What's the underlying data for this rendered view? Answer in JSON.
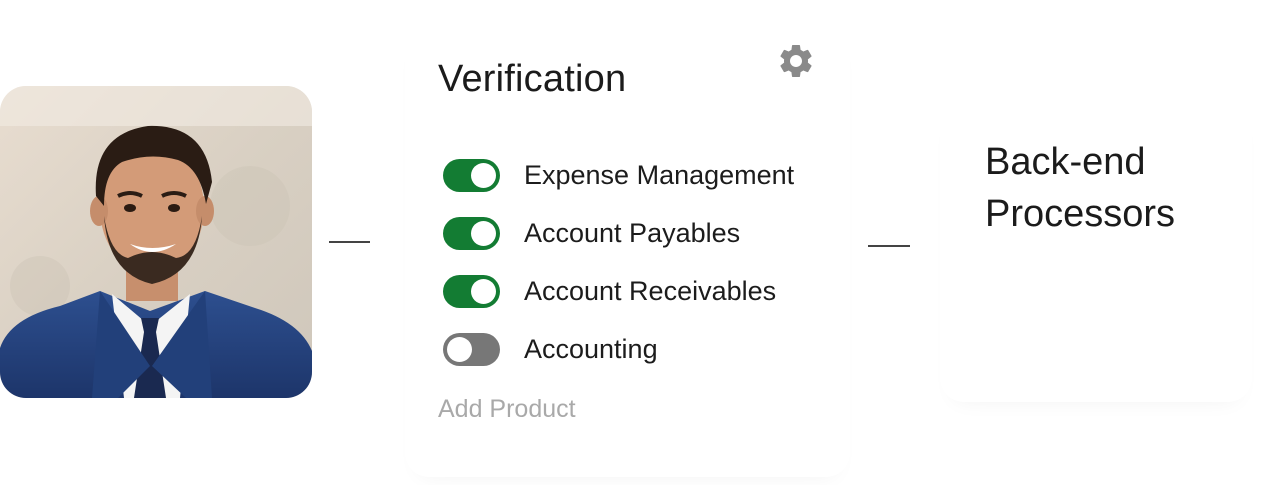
{
  "verification": {
    "title": "Verification",
    "products": [
      {
        "label": "Expense Management",
        "enabled": true
      },
      {
        "label": "Account Payables",
        "enabled": true
      },
      {
        "label": "Account Receivables",
        "enabled": true
      },
      {
        "label": "Accounting",
        "enabled": false
      }
    ],
    "add_product_label": "Add Product",
    "settings_icon": "gear-icon"
  },
  "backend": {
    "title": "Back-end Processors"
  },
  "colors": {
    "toggle_on": "#137c33",
    "toggle_off": "#777777",
    "muted_text": "#a9a9a9",
    "icon_gray": "#8a8a8a"
  }
}
